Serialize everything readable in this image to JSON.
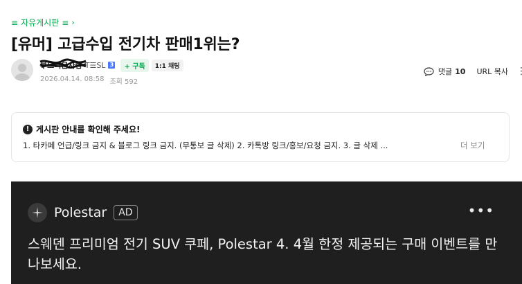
{
  "breadcrumb": {
    "menu_symbol": "≡",
    "board": "자유게시판",
    "tail_symbol": "≡",
    "chevron": "›"
  },
  "post": {
    "title": "[유머] 고급수입 전기차 판매1위는?",
    "author": {
      "nickname": "부드러운사람",
      "rank": "T☰SL",
      "rank_badge": "3",
      "subscribe_label": "+ 구독",
      "chat_label": "1:1 채팅"
    },
    "date": "2026.04.14. 08:58",
    "views": "조회 592"
  },
  "actions": {
    "comment_label": "댓글",
    "comment_count": "10",
    "url_copy_label": "URL 복사",
    "more_symbol": "⋮"
  },
  "notice": {
    "heading": "게시판 안내를 확인해 주세요!",
    "icon_glyph": "!",
    "body": "1. 타카페 언급/링크 금지 & 블로그 링크 금지. (무통보 글 삭제) 2. 카톡방 링크/홍보/요청 금지. 3. 글 삭제 ...",
    "more_label": "더 보기"
  },
  "ad": {
    "brand": "Polestar",
    "badge": "AD",
    "more_symbol": "•••",
    "text": "스웨덴 프리미엄 전기 SUV 쿠페, Polestar 4. 4월 한정 제공되는 구매 이벤트를 만나보세요."
  },
  "colors": {
    "accent_green": "#03a94d",
    "ad_background": "#1f1f1f",
    "rank_badge_blue": "#4b79ff"
  }
}
